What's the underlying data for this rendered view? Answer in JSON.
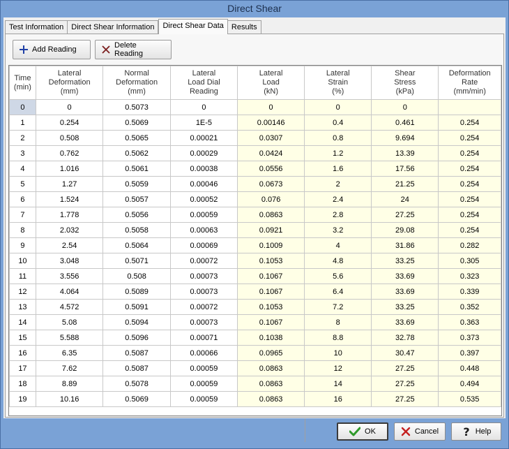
{
  "window": {
    "title": "Direct Shear"
  },
  "tabs": [
    {
      "label": "Test Information"
    },
    {
      "label": "Direct Shear Information"
    },
    {
      "label": "Direct Shear Data"
    },
    {
      "label": "Results"
    }
  ],
  "active_tab": 2,
  "toolbar": {
    "add_label": "Add Reading",
    "delete_label": "Delete Reading"
  },
  "colors": {
    "calc_cell": "#ffffe6",
    "add_icon": "#1f3fa6",
    "delete_icon": "#7a1d1d",
    "ok_icon": "#2e9a2a",
    "cancel_icon": "#c42020"
  },
  "table": {
    "columns": [
      [
        "Time",
        "(min)"
      ],
      [
        "Lateral",
        "Deformation",
        "(mm)"
      ],
      [
        "Normal",
        "Deformation",
        "(mm)"
      ],
      [
        "Lateral",
        "Load Dial",
        "Reading"
      ],
      [
        "Lateral",
        "Load",
        "(kN)"
      ],
      [
        "Lateral",
        "Strain",
        "(%)"
      ],
      [
        "Shear",
        "Stress",
        "(kPa)"
      ],
      [
        "Deformation",
        "Rate",
        "(mm/min)"
      ]
    ],
    "rows": [
      [
        "0",
        "0",
        "0.5073",
        "0",
        "0",
        "0",
        "0",
        ""
      ],
      [
        "1",
        "0.254",
        "0.5069",
        "1E-5",
        "0.00146",
        "0.4",
        "0.461",
        "0.254"
      ],
      [
        "2",
        "0.508",
        "0.5065",
        "0.00021",
        "0.0307",
        "0.8",
        "9.694",
        "0.254"
      ],
      [
        "3",
        "0.762",
        "0.5062",
        "0.00029",
        "0.0424",
        "1.2",
        "13.39",
        "0.254"
      ],
      [
        "4",
        "1.016",
        "0.5061",
        "0.00038",
        "0.0556",
        "1.6",
        "17.56",
        "0.254"
      ],
      [
        "5",
        "1.27",
        "0.5059",
        "0.00046",
        "0.0673",
        "2",
        "21.25",
        "0.254"
      ],
      [
        "6",
        "1.524",
        "0.5057",
        "0.00052",
        "0.076",
        "2.4",
        "24",
        "0.254"
      ],
      [
        "7",
        "1.778",
        "0.5056",
        "0.00059",
        "0.0863",
        "2.8",
        "27.25",
        "0.254"
      ],
      [
        "8",
        "2.032",
        "0.5058",
        "0.00063",
        "0.0921",
        "3.2",
        "29.08",
        "0.254"
      ],
      [
        "9",
        "2.54",
        "0.5064",
        "0.00069",
        "0.1009",
        "4",
        "31.86",
        "0.282"
      ],
      [
        "10",
        "3.048",
        "0.5071",
        "0.00072",
        "0.1053",
        "4.8",
        "33.25",
        "0.305"
      ],
      [
        "11",
        "3.556",
        "0.508",
        "0.00073",
        "0.1067",
        "5.6",
        "33.69",
        "0.323"
      ],
      [
        "12",
        "4.064",
        "0.5089",
        "0.00073",
        "0.1067",
        "6.4",
        "33.69",
        "0.339"
      ],
      [
        "13",
        "4.572",
        "0.5091",
        "0.00072",
        "0.1053",
        "7.2",
        "33.25",
        "0.352"
      ],
      [
        "14",
        "5.08",
        "0.5094",
        "0.00073",
        "0.1067",
        "8",
        "33.69",
        "0.363"
      ],
      [
        "15",
        "5.588",
        "0.5096",
        "0.00071",
        "0.1038",
        "8.8",
        "32.78",
        "0.373"
      ],
      [
        "16",
        "6.35",
        "0.5087",
        "0.00066",
        "0.0965",
        "10",
        "30.47",
        "0.397"
      ],
      [
        "17",
        "7.62",
        "0.5087",
        "0.00059",
        "0.0863",
        "12",
        "27.25",
        "0.448"
      ],
      [
        "18",
        "8.89",
        "0.5078",
        "0.00059",
        "0.0863",
        "14",
        "27.25",
        "0.494"
      ],
      [
        "19",
        "10.16",
        "0.5069",
        "0.00059",
        "0.0863",
        "16",
        "27.25",
        "0.535"
      ]
    ],
    "calculated_columns": [
      4,
      5,
      6,
      7
    ],
    "selected_row": 0
  },
  "buttons": {
    "ok": "OK",
    "cancel": "Cancel",
    "help": "Help"
  }
}
